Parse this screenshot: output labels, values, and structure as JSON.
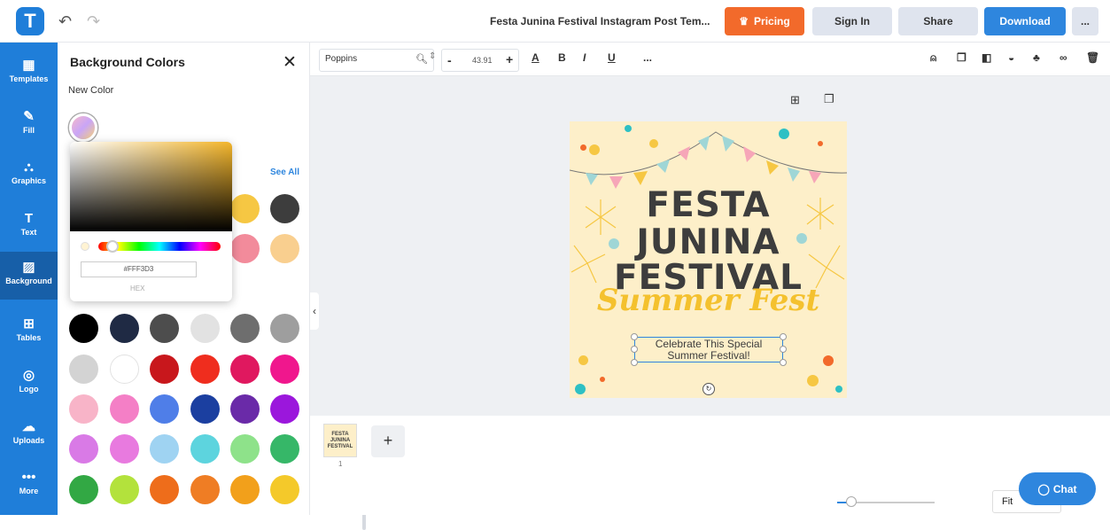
{
  "header": {
    "logo_letter": "T",
    "undo": "↶",
    "redo": "↷",
    "doc_title": "Festa Junina Festival Instagram Post Tem...",
    "pricing": "Pricing",
    "sign_in": "Sign In",
    "share": "Share",
    "download": "Download",
    "more": "..."
  },
  "sidebar": {
    "items": [
      {
        "label": "Templates",
        "icon": "▦"
      },
      {
        "label": "Fill",
        "icon": "✎"
      },
      {
        "label": "Graphics",
        "icon": "⛬"
      },
      {
        "label": "Text",
        "icon": "T"
      },
      {
        "label": "Background",
        "icon": "▨"
      },
      {
        "label": "Tables",
        "icon": "⊞"
      },
      {
        "label": "Logo",
        "icon": "◎"
      },
      {
        "label": "Uploads",
        "icon": "☁"
      },
      {
        "label": "More",
        "icon": "•••"
      }
    ]
  },
  "panel": {
    "title": "Background Colors",
    "close": "✕",
    "new_color": "New Color",
    "see_all": "See All",
    "picker": {
      "hex": "#FFF3D3",
      "hex_label": "HEX"
    },
    "swatches_top": [
      "#f6c743",
      "#3d3d3d",
      "#f28b9b",
      "#f9cf8f"
    ],
    "swatch_rows": [
      [
        "#000000",
        "#1f2a44",
        "#4d4d4d",
        "#e2e2e2",
        "#6e6e6e",
        "#9e9e9e"
      ],
      [
        "#d3d3d3",
        "#ffffff",
        "#c8171c",
        "#ef2d1e",
        "#e0185f",
        "#f0178d"
      ],
      [
        "#f8b4c8",
        "#f47fc6",
        "#4f7ee8",
        "#1b3fa0",
        "#6a2aa8",
        "#9b17dc"
      ],
      [
        "#d97ae6",
        "#e87adf",
        "#9fd3f2",
        "#5dd4de",
        "#8ee28a",
        "#36b768"
      ],
      [
        "#32a844",
        "#b3e23c",
        "#ee6d1b",
        "#ef7d24",
        "#f2a01b",
        "#f4c92a"
      ]
    ]
  },
  "toolbar": {
    "font": "Poppins",
    "font_size": "43.91",
    "minus": "-",
    "plus": "+",
    "more": "..."
  },
  "post": {
    "title_lines": [
      "FESTA",
      "JUNINA",
      "FESTIVAL"
    ],
    "script": "Summer Fest",
    "subtitle_1": "Celebrate This Special",
    "subtitle_2": "Summer Festival!"
  },
  "pages": {
    "thumb_text": "FESTA JUNINA FESTIVAL",
    "page_number": "1",
    "add": "+"
  },
  "zoom": {
    "fit": "Fit",
    "level": 0.1
  },
  "chat": {
    "label": "Chat"
  },
  "colors": {
    "brand": "#1f7ed9",
    "accent": "#f26a2b",
    "primary": "#2e86de"
  }
}
